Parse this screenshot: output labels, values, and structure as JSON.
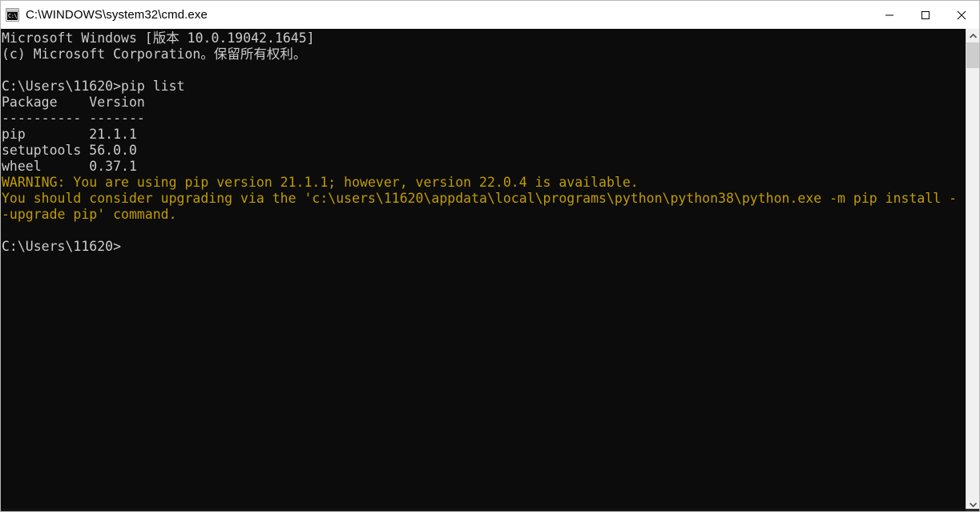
{
  "window": {
    "title": "C:\\WINDOWS\\system32\\cmd.exe",
    "icon": "cmd-console-icon",
    "icon_glyph": "C:\\",
    "background_color": "#0c0c0c",
    "titlebar_color": "#ffffff"
  },
  "controls": {
    "minimize_label": "Minimize",
    "maximize_label": "Maximize",
    "close_label": "Close"
  },
  "console": {
    "default_text_color": "#cccccc",
    "warning_text_color": "#c19c00",
    "lines": [
      {
        "text": "Microsoft Windows [版本 10.0.19042.1645]",
        "color": "default"
      },
      {
        "text": "(c) Microsoft Corporation。保留所有权利。",
        "color": "default"
      },
      {
        "text": "",
        "color": "default"
      },
      {
        "text": "C:\\Users\\11620>pip list",
        "color": "default"
      },
      {
        "text": "Package    Version",
        "color": "default"
      },
      {
        "text": "---------- -------",
        "color": "default"
      },
      {
        "text": "pip        21.1.1",
        "color": "default"
      },
      {
        "text": "setuptools 56.0.0",
        "color": "default"
      },
      {
        "text": "wheel      0.37.1",
        "color": "default"
      },
      {
        "text": "WARNING: You are using pip version 21.1.1; however, version 22.0.4 is available.",
        "color": "warn"
      },
      {
        "text": "You should consider upgrading via the 'c:\\users\\11620\\appdata\\local\\programs\\python\\python38\\python.exe -m pip install -",
        "color": "warn"
      },
      {
        "text": "-upgrade pip' command.",
        "color": "warn"
      },
      {
        "text": "",
        "color": "default"
      },
      {
        "text": "C:\\Users\\11620>",
        "color": "default"
      }
    ],
    "command_entered": "pip list",
    "prompt": "C:\\Users\\11620>",
    "package_table": {
      "headers": [
        "Package",
        "Version"
      ],
      "rows": [
        [
          "pip",
          "21.1.1"
        ],
        [
          "setuptools",
          "56.0.0"
        ],
        [
          "wheel",
          "0.37.1"
        ]
      ]
    },
    "os_version": "10.0.19042.1645",
    "pip_current_version": "21.1.1",
    "pip_available_version": "22.0.4",
    "python_path": "c:\\users\\11620\\appdata\\local\\programs\\python\\python38\\python.exe"
  },
  "scrollbar": {
    "up_arrow": "chevron-up-icon",
    "down_arrow": "chevron-down-icon",
    "thumb_position_percent": 0
  }
}
